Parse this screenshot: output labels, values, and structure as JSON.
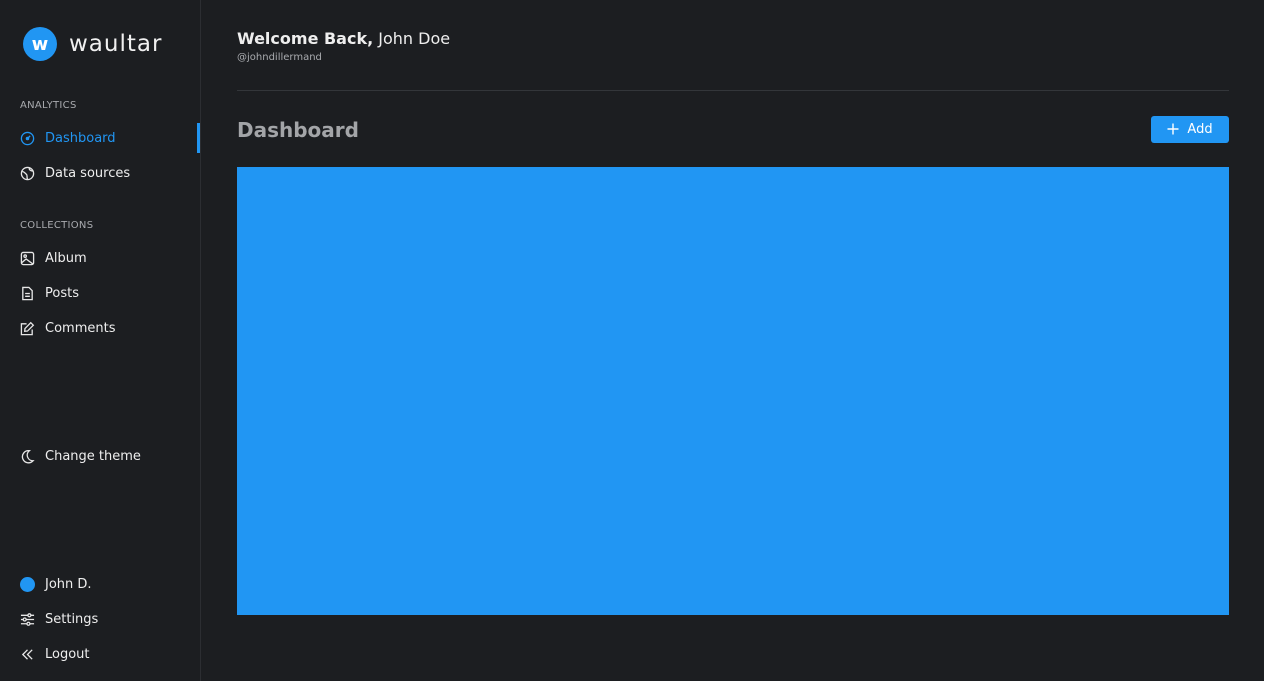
{
  "app": {
    "logo_letter": "w",
    "name": "waultar"
  },
  "sidebar": {
    "analytics_label": "ANALYTICS",
    "collections_label": "COLLECTIONS",
    "items": {
      "dashboard": "Dashboard",
      "data_sources": "Data sources",
      "album": "Album",
      "posts": "Posts",
      "comments": "Comments",
      "change_theme": "Change theme",
      "user": "John D.",
      "settings": "Settings",
      "logout": "Logout"
    }
  },
  "header": {
    "welcome_bold": "Welcome Back,",
    "welcome_name": " John Doe",
    "username": "@johndillermand"
  },
  "main": {
    "title": "Dashboard",
    "add_label": "Add",
    "add_icon": "plus-icon"
  },
  "colors": {
    "accent": "#2196f3",
    "background": "#1c1e21"
  }
}
